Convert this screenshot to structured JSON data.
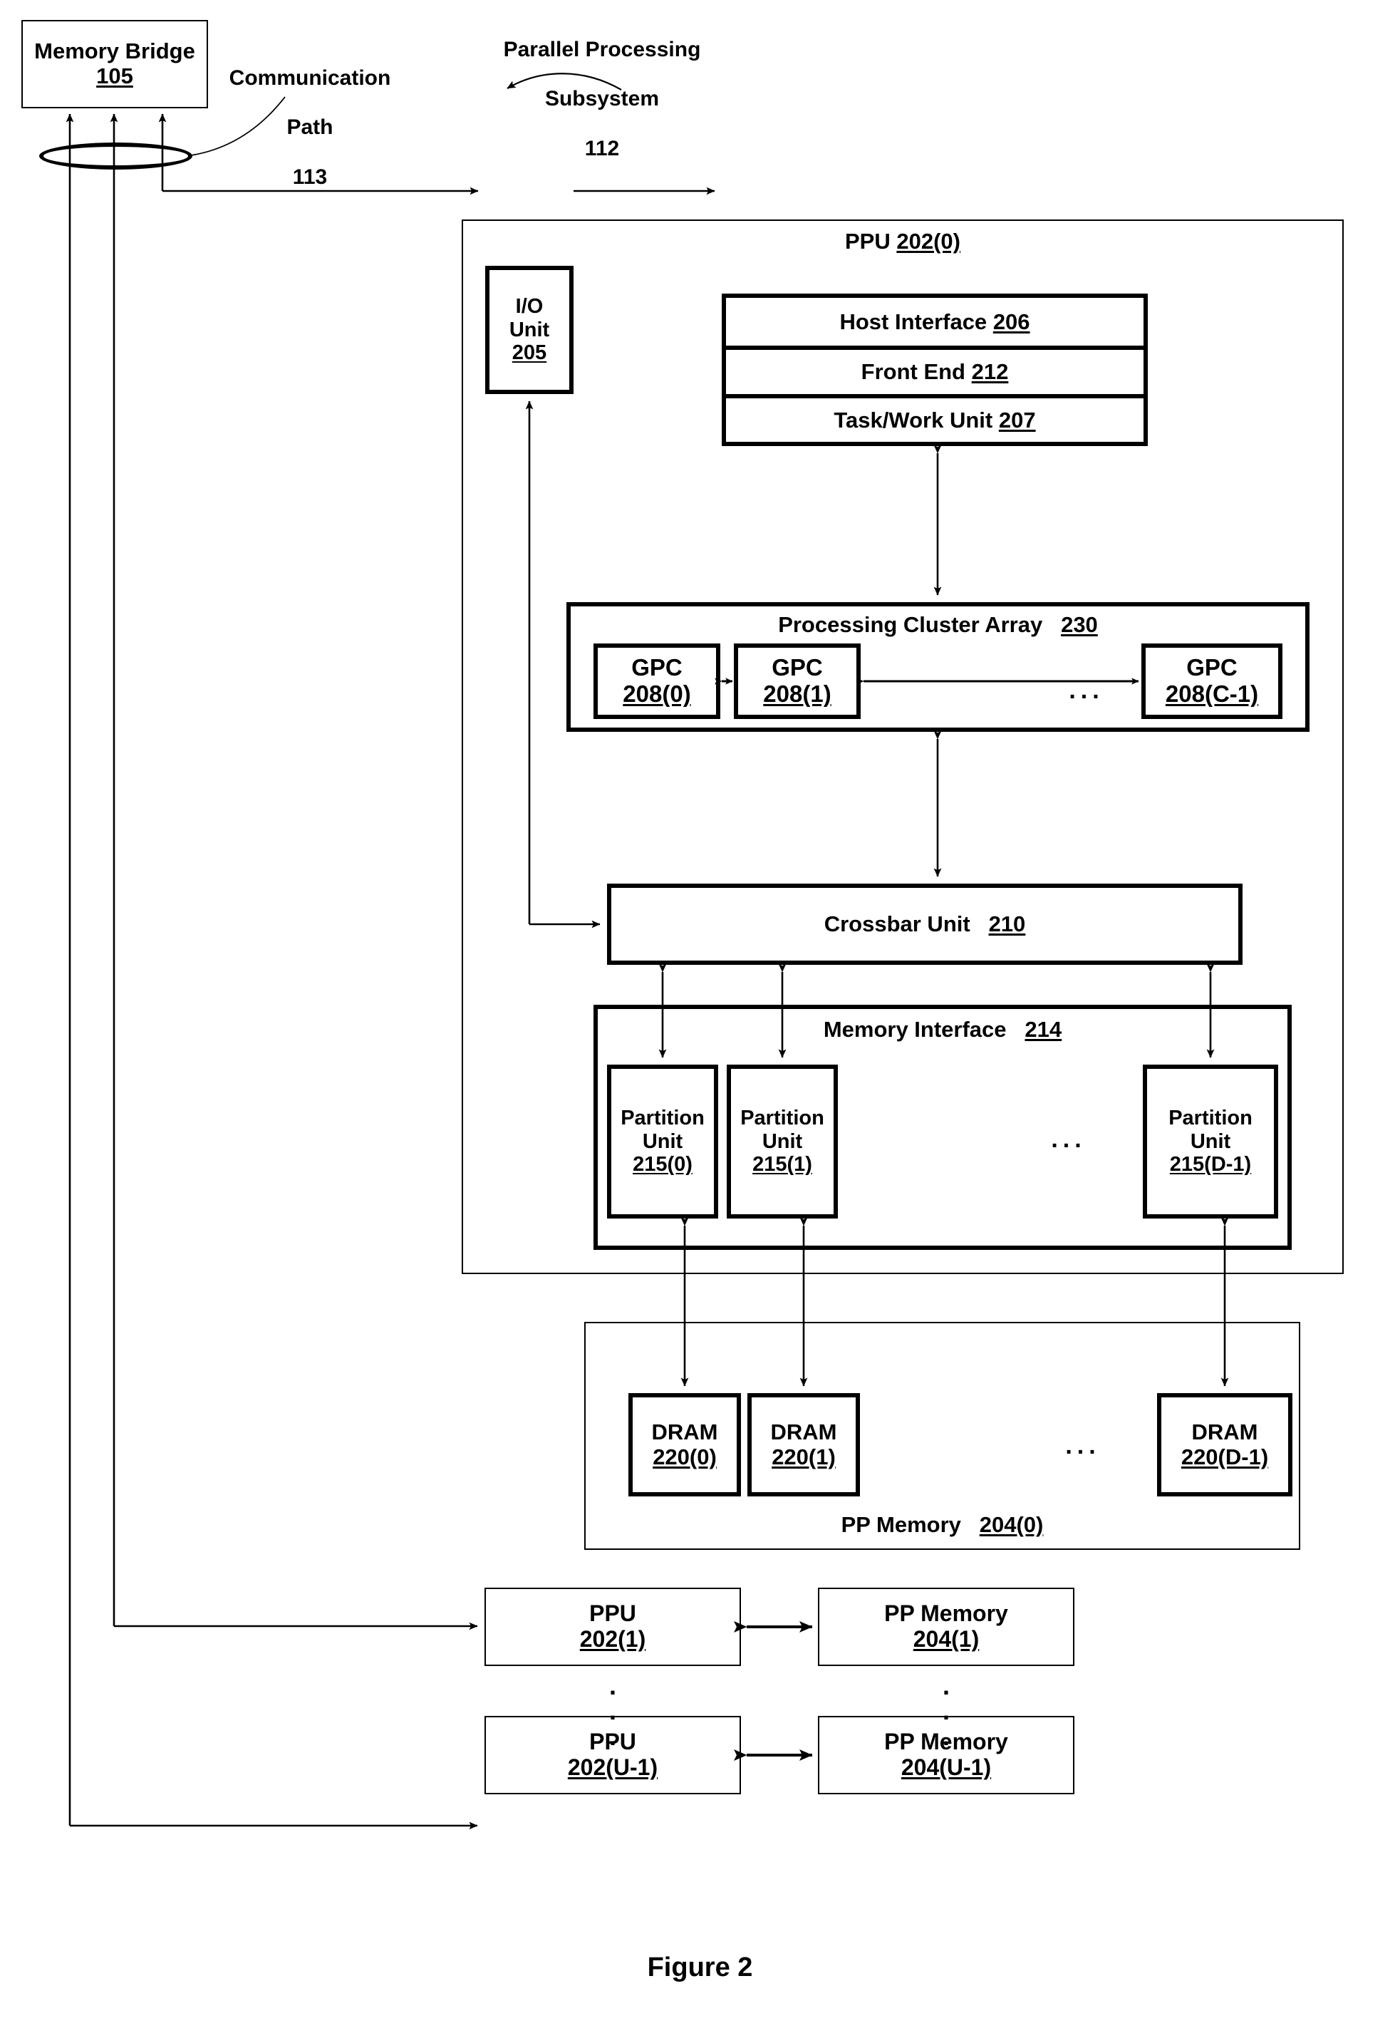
{
  "figure": {
    "caption": "Figure 2"
  },
  "annotations": {
    "memory_bridge": {
      "title": "Memory Bridge",
      "ref": "105"
    },
    "communication_path": {
      "line1": "Communication",
      "line2": "Path",
      "ref": "113"
    },
    "parallel_processing_subsystem": {
      "line1": "Parallel Processing",
      "line2": "Subsystem",
      "ref": "112"
    }
  },
  "ppu0": {
    "title": "PPU",
    "ref": "202(0)",
    "io_unit": {
      "line1": "I/O",
      "line2": "Unit",
      "ref": "205"
    },
    "front_stack": [
      {
        "label": "Host Interface",
        "ref": "206"
      },
      {
        "label": "Front End",
        "ref": "212"
      },
      {
        "label": "Task/Work Unit",
        "ref": "207"
      }
    ],
    "processing_cluster_array": {
      "label": "Processing Cluster Array",
      "ref": "230",
      "gpcs": [
        {
          "label": "GPC",
          "ref": "208(0)"
        },
        {
          "label": "GPC",
          "ref": "208(1)"
        },
        {
          "label": "GPC",
          "ref": "208(C-1)"
        }
      ],
      "ellipsis": "..."
    },
    "crossbar_unit": {
      "label": "Crossbar Unit",
      "ref": "210"
    },
    "memory_interface": {
      "label": "Memory Interface",
      "ref": "214",
      "partition_units": [
        {
          "line1": "Partition",
          "line2": "Unit",
          "ref": "215(0)"
        },
        {
          "line1": "Partition",
          "line2": "Unit",
          "ref": "215(1)"
        },
        {
          "line1": "Partition",
          "line2": "Unit",
          "ref": "215(D-1)"
        }
      ],
      "ellipsis": "..."
    }
  },
  "pp_memory_0": {
    "label": "PP Memory",
    "ref": "204(0)",
    "drams": [
      {
        "label": "DRAM",
        "ref": "220(0)"
      },
      {
        "label": "DRAM",
        "ref": "220(1)"
      },
      {
        "label": "DRAM",
        "ref": "220(D-1)"
      }
    ],
    "ellipsis": "..."
  },
  "additional_units": {
    "vertical_ellipsis": ".\n.\n.",
    "rows": [
      {
        "ppu": {
          "label": "PPU",
          "ref": "202(1)"
        },
        "memory": {
          "label": "PP Memory",
          "ref": "204(1)"
        }
      },
      {
        "ppu": {
          "label": "PPU",
          "ref": "202(U-1)"
        },
        "memory": {
          "label": "PP Memory",
          "ref": "204(U-1)"
        }
      }
    ]
  },
  "colors": {
    "ink": "#000000",
    "paper": "#ffffff"
  }
}
